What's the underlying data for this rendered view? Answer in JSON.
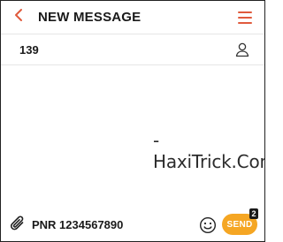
{
  "header": {
    "title": "NEW MESSAGE",
    "back_icon": "chevron-left-icon",
    "menu_icon": "hamburger-menu-icon",
    "accent_color": "#e05a3c"
  },
  "recipient": {
    "value": "139",
    "contact_icon": "person-icon"
  },
  "conversation": {
    "watermark": "-HaxiTrick.Com"
  },
  "compose": {
    "attach_icon": "paperclip-icon",
    "message_text": "PNR 1234567890",
    "emoji_icon": "smiley-icon",
    "send_label": "SEND",
    "send_color": "#f5a623",
    "sms_count": "2"
  }
}
